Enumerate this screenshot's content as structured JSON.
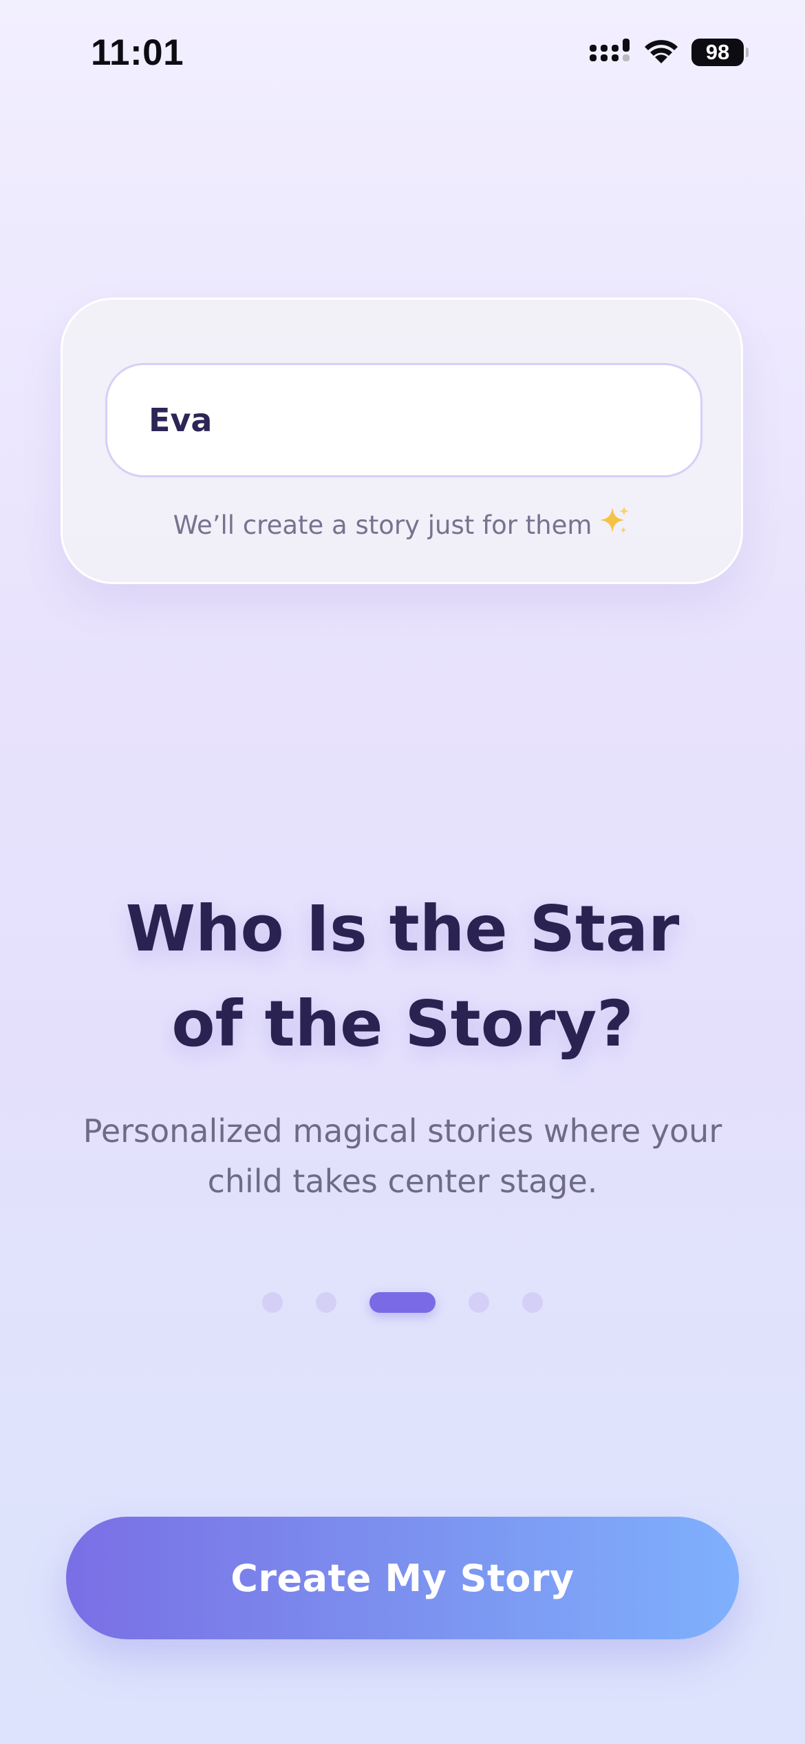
{
  "status_bar": {
    "time": "11:01",
    "battery": "98",
    "icons": [
      "signal-icon",
      "wifi-icon",
      "battery-icon"
    ]
  },
  "name_card": {
    "input_value": "Eva",
    "hint": "We’ll create a story just for them",
    "hint_icon": "sparkle-icon"
  },
  "headline": "Who Is the Star of the Story?",
  "subtitle": "Personalized magical stories where your child takes center stage.",
  "pagination": {
    "total": 5,
    "active_index": 2
  },
  "cta": {
    "label": "Create My Story"
  },
  "colors": {
    "accent": "#7b6ae6",
    "cta_start": "#7a6fe5",
    "cta_end": "#7fb0fd",
    "text_dark": "#2a2352",
    "text_muted": "#6f6a88"
  }
}
